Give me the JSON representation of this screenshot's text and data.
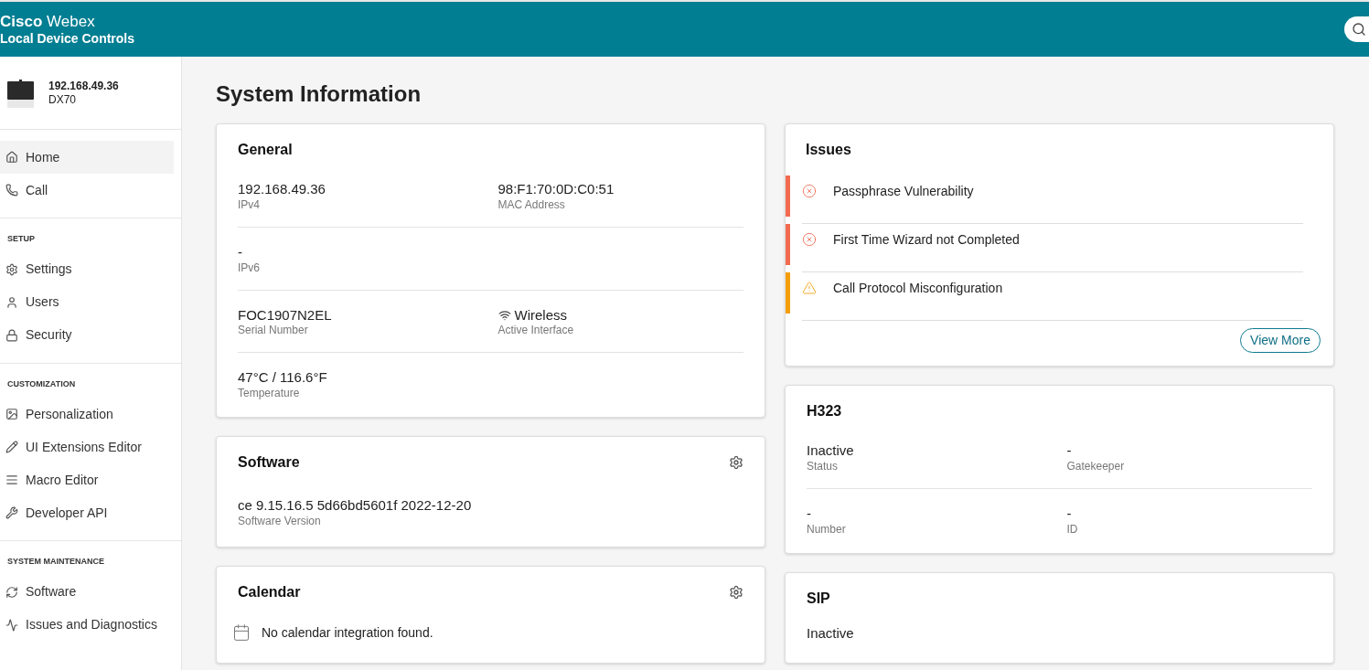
{
  "header": {
    "brand_bold": "Cisco",
    "brand_light": "Webex",
    "subtitle": "Local Device Controls"
  },
  "device": {
    "address": "192.168.49.36",
    "model": "DX70"
  },
  "nav": [
    {
      "items": [
        {
          "label": "Home",
          "selected": true
        },
        {
          "label": "Call",
          "selected": false
        }
      ]
    },
    {
      "heading": "SETUP",
      "items": [
        {
          "label": "Settings",
          "selected": false
        },
        {
          "label": "Users",
          "selected": false
        },
        {
          "label": "Security",
          "selected": false
        }
      ]
    },
    {
      "heading": "CUSTOMIZATION",
      "items": [
        {
          "label": "Personalization",
          "selected": false
        },
        {
          "label": "UI Extensions Editor",
          "selected": false
        },
        {
          "label": "Macro Editor",
          "selected": false
        },
        {
          "label": "Developer API",
          "selected": false
        }
      ]
    },
    {
      "heading": "SYSTEM MAINTENANCE",
      "items": [
        {
          "label": "Software",
          "selected": false
        },
        {
          "label": "Issues and Diagnostics",
          "selected": false
        }
      ]
    }
  ],
  "page_title": "System Information",
  "general": {
    "title": "General",
    "rows": [
      [
        {
          "kind": "text",
          "value": "192.168.49.36",
          "label": "IPv4"
        },
        {
          "kind": "text",
          "value": "98:F1:70:0D:C0:51",
          "label": "MAC Address"
        }
      ],
      [
        {
          "kind": "text",
          "value": "-",
          "label": "IPv6"
        }
      ],
      [
        {
          "kind": "text",
          "value": "FOC1907N2EL",
          "label": "Serial Number"
        },
        {
          "kind": "wireless",
          "value": "Wireless",
          "label": "Active Interface"
        }
      ],
      [
        {
          "kind": "text",
          "value": "47°C / 116.6°F",
          "label": "Temperature"
        }
      ]
    ]
  },
  "software": {
    "title": "Software",
    "value": "ce 9.15.16.5 5d66bd5601f 2022-12-20",
    "label": "Software Version"
  },
  "calendar": {
    "title": "Calendar",
    "message": "No calendar integration found."
  },
  "issues": {
    "title": "Issues",
    "items": [
      {
        "kind": "error",
        "text": "Passphrase Vulnerability"
      },
      {
        "kind": "error",
        "text": "First Time Wizard not Completed"
      },
      {
        "kind": "warning",
        "text": "Call Protocol Misconfiguration"
      }
    ],
    "button": "View More"
  },
  "h323": {
    "title": "H323",
    "rows": [
      [
        {
          "value": "Inactive",
          "label": "Status"
        },
        {
          "value": "-",
          "label": "Gatekeeper"
        }
      ],
      [
        {
          "value": "-",
          "label": "Number"
        },
        {
          "value": "-",
          "label": "ID"
        }
      ]
    ]
  },
  "sip": {
    "title": "SIP",
    "value": "Inactive"
  }
}
